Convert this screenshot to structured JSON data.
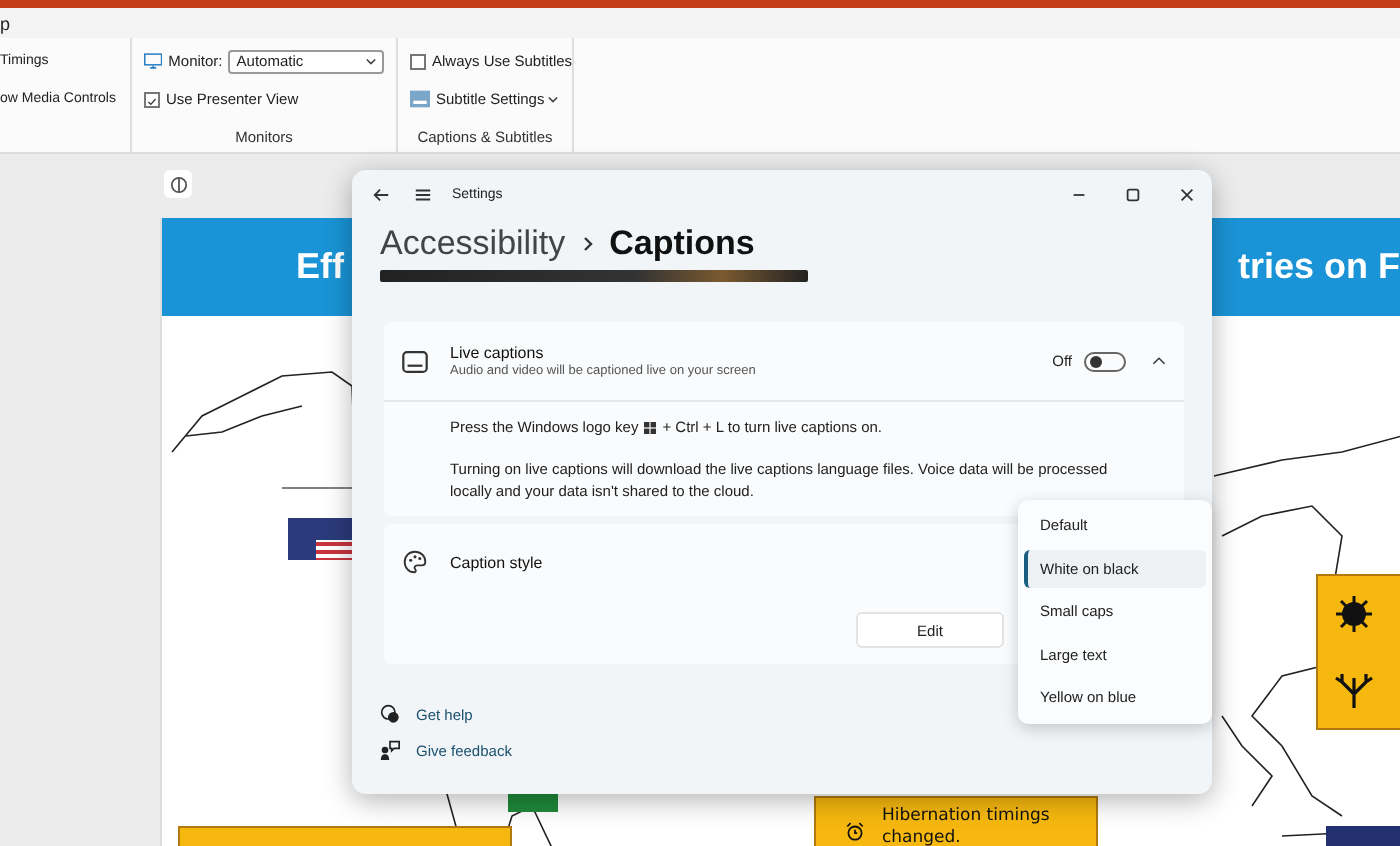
{
  "app_title": "p",
  "ribbon": {
    "groups": [
      {
        "items": [
          {
            "kind": "text",
            "label": "Timings"
          },
          {
            "kind": "text",
            "label": "ow Media Controls"
          }
        ]
      },
      {
        "label": "Monitors",
        "items": [
          {
            "kind": "select",
            "label": "Monitor:",
            "value": "Automatic"
          },
          {
            "kind": "checkbox",
            "label": "Use Presenter View",
            "checked": true
          }
        ]
      },
      {
        "label": "Captions & Subtitles",
        "items": [
          {
            "kind": "checkbox",
            "label": "Always Use Subtitles",
            "checked": false
          },
          {
            "kind": "menu_button",
            "label": "Subtitle Settings"
          }
        ]
      }
    ]
  },
  "slide": {
    "banner_left": "Eff",
    "banner_right": "tries on F",
    "callouts": [
      {
        "text": "Hibernation timings changed."
      }
    ]
  },
  "settings_window": {
    "title": "Settings",
    "breadcrumb": {
      "parent": "Accessibility",
      "current": "Captions"
    },
    "live_captions": {
      "title": "Live captions",
      "subtitle": "Audio and video will be captioned live on your screen",
      "state_label": "Off",
      "on": false,
      "expanded": true,
      "hint_before": "Press the Windows logo key",
      "hint_after": "+ Ctrl + L to turn live captions on.",
      "note": "Turning on live captions will download the live captions language files. Voice data will be processed locally and your data isn't shared to the cloud."
    },
    "caption_style": {
      "title": "Caption style",
      "button": "Edit",
      "menu": [
        {
          "label": "Default",
          "selected": false
        },
        {
          "label": "White on black",
          "selected": true
        },
        {
          "label": "Small caps",
          "selected": false
        },
        {
          "label": "Large text",
          "selected": false
        },
        {
          "label": "Yellow on blue",
          "selected": false
        }
      ]
    },
    "footer_links": [
      {
        "kind": "help",
        "label": "Get help"
      },
      {
        "kind": "feedback",
        "label": "Give feedback"
      }
    ]
  }
}
